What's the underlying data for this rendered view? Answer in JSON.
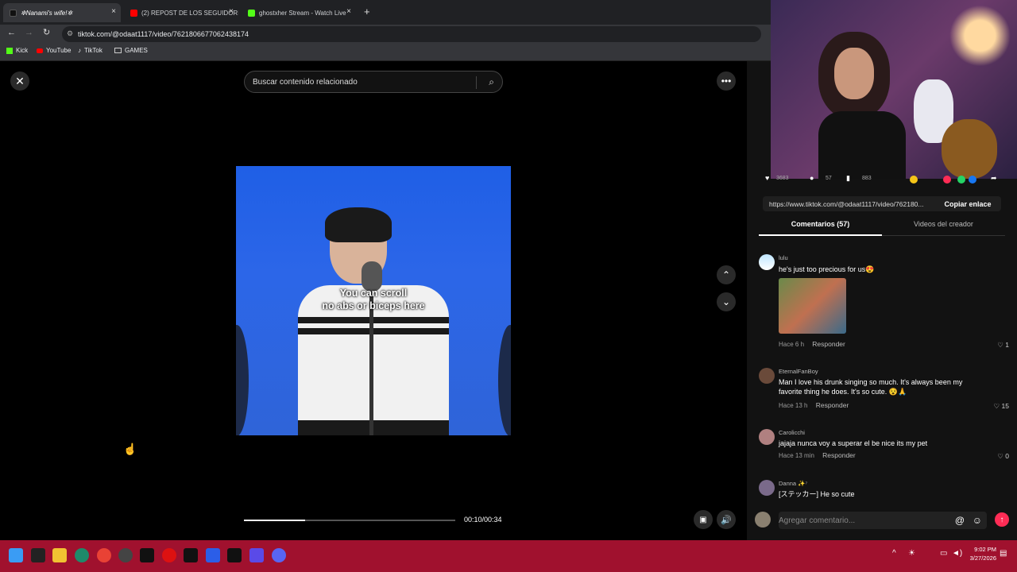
{
  "browser": {
    "tabs": [
      {
        "label": "✲Nanami's wife!✲",
        "active": true
      },
      {
        "label": "(2) REPOST DE LOS SEGUIDORE",
        "active": false
      },
      {
        "label": "ghostxher Stream - Watch Live",
        "active": false
      }
    ],
    "new_tab": "+",
    "url": "tiktok.com/@odaat1117/video/7621806677062438174",
    "bookmarks": [
      "Kick",
      "YouTube",
      "TikTok",
      "GAMES"
    ]
  },
  "viewer": {
    "close_icon": "close-icon",
    "search_placeholder": "Buscar contenido relacionado",
    "more_icon": "more-icon",
    "caption_line1": "You can scroll",
    "caption_line2": "no abs or biceps here",
    "time": "00:10/00:34",
    "progress": 0.29
  },
  "panel": {
    "stats": [
      "3683",
      "57",
      "883"
    ],
    "link": "https://www.tiktok.com/@odaat1117/video/762180...",
    "copy_label": "Copiar enlace",
    "tab_comments": "Comentarios (57)",
    "tab_creator": "Videos del creador",
    "comments": [
      {
        "user": "lulu",
        "text": "he's just too precious for us😍",
        "time": "Hace 6 h",
        "reply": "Responder",
        "likes": "1"
      },
      {
        "user": "EternalFanBoy",
        "text": "Man I love his drunk singing so much. It's always been my favorite thing he does. It's so cute. 😵🙏",
        "time": "Hace 13 h",
        "reply": "Responder",
        "likes": "15"
      },
      {
        "user": "Carolicchi",
        "text": "jajaja nunca voy a superar el be nice its my pet",
        "time": "Hace 13 min",
        "reply": "Responder",
        "likes": "0"
      },
      {
        "user": "Danna ✨⁷",
        "text": "[ステッカー] He so cute",
        "time": "",
        "reply": "",
        "likes": ""
      }
    ],
    "comment_placeholder": "Agregar comentario..."
  },
  "taskbar": {
    "time": "9:02 PM",
    "date": "3/27/2026"
  },
  "colors": {
    "taskbar": "#a0112e",
    "tiktok_accent": "#fe2c55"
  }
}
